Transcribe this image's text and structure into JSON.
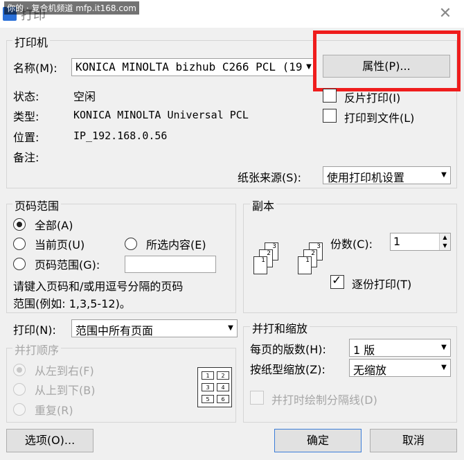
{
  "window": {
    "title": "打印",
    "watermark": "你的 · 复合机频道 mfp.it168.com",
    "close_glyph": "✕"
  },
  "printer_group": {
    "legend": "打印机",
    "name_label": "名称(M):",
    "name_value": "KONICA MINOLTA bizhub C266 PCL (19",
    "properties_button": "属性(P)...",
    "status_label": "状态:",
    "status_value": "空闲",
    "type_label": "类型:",
    "type_value": "KONICA MINOLTA Universal PCL",
    "location_label": "位置:",
    "location_value": "IP_192.168.0.56",
    "comment_label": "备注:",
    "reverse_print_label": "反片打印(I)",
    "print_to_file_label": "打印到文件(L)",
    "paper_source_label": "纸张来源(S):",
    "paper_source_value": "使用打印机设置"
  },
  "page_range_group": {
    "legend": "页码范围",
    "all_label": "全部(A)",
    "current_page_label": "当前页(U)",
    "selection_label": "所选内容(E)",
    "pages_label": "页码范围(G):",
    "pages_value": "",
    "hint_line1": "请键入页码和/或用逗号分隔的页码",
    "hint_line2": "范围(例如: 1,3,5-12)。",
    "selected": "all"
  },
  "copies_group": {
    "legend": "副本",
    "copies_label": "份数(C):",
    "copies_value": "1",
    "collate_label": "逐份打印(T)",
    "collate_checked": true
  },
  "print_what": {
    "label": "打印(N):",
    "value": "范围中所有页面"
  },
  "page_order_group": {
    "legend": "并打顺序",
    "left_to_right_label": "从左到右(F)",
    "top_to_bottom_label": "从上到下(B)",
    "repeat_label": "重复(R)",
    "nup_cells": [
      "1",
      "2",
      "3",
      "4",
      "5",
      "6"
    ]
  },
  "zoom_group": {
    "legend": "并打和缩放",
    "pages_per_sheet_label": "每页的版数(H):",
    "pages_per_sheet_value": "1 版",
    "scale_to_paper_label": "按纸型缩放(Z):",
    "scale_to_paper_value": "无缩放",
    "draw_borders_label": "并打时绘制分隔线(D)"
  },
  "footer": {
    "options_button": "选项(O)...",
    "ok_button": "确定",
    "cancel_button": "取消"
  },
  "collate_icon_pages": [
    "1",
    "2",
    "3"
  ],
  "colors": {
    "highlight": "#ef1d1d",
    "dialog_bg": "#f0f0f0",
    "disabled_text": "#a6a6a6"
  }
}
